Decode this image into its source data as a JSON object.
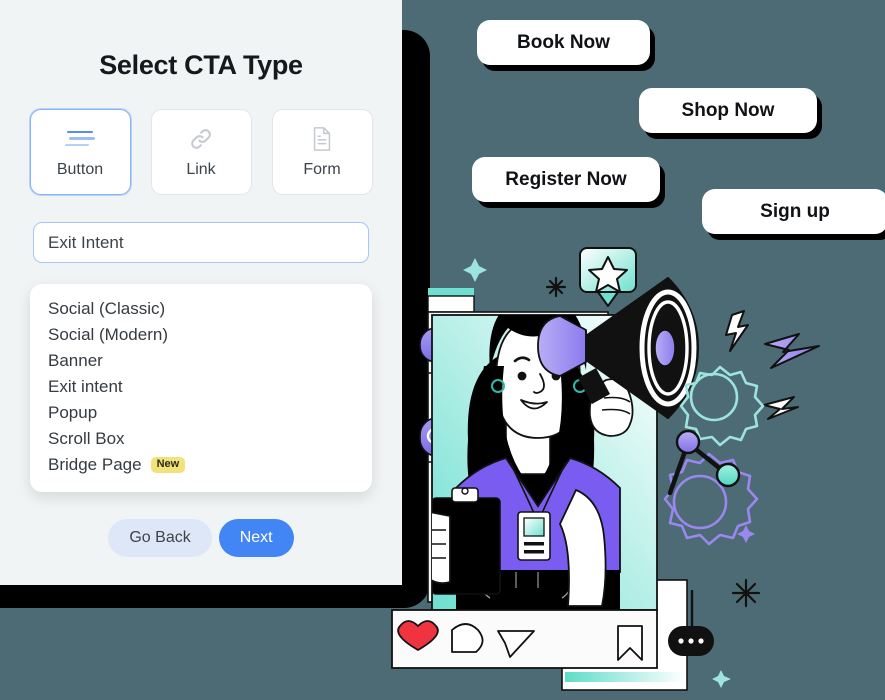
{
  "theme": {
    "background_teal": "#4c6b74",
    "panel_background": "#f1f4f5",
    "accent_blue": "#4285f4",
    "badge_yellow": "#f2e27a",
    "card_black": "#000000"
  },
  "panel": {
    "title": "Select CTA Type",
    "type_cards": [
      {
        "label": "Button",
        "icon": "lines-icon",
        "selected": true
      },
      {
        "label": "Link",
        "icon": "link-icon",
        "selected": false
      },
      {
        "label": "Form",
        "icon": "document-icon",
        "selected": false
      }
    ],
    "select_input": {
      "value": "Exit Intent",
      "placeholder": "Exit Intent"
    },
    "dropdown_options": [
      {
        "label": "Social (Classic)",
        "badge": ""
      },
      {
        "label": "Social (Modern)",
        "badge": ""
      },
      {
        "label": "Banner",
        "badge": ""
      },
      {
        "label": "Exit intent",
        "badge": ""
      },
      {
        "label": "Popup",
        "badge": ""
      },
      {
        "label": "Scroll Box",
        "badge": ""
      },
      {
        "label": "Bridge Page",
        "badge": "New"
      }
    ],
    "actions": {
      "back_label": "Go Back",
      "next_label": "Next"
    }
  },
  "preview": {
    "cta_buttons": [
      {
        "label": "Book Now"
      },
      {
        "label": "Shop Now"
      },
      {
        "label": "Register Now"
      },
      {
        "label": "Sign up"
      }
    ],
    "illustration": {
      "name": "marketing-megaphone-illustration",
      "social_actions": [
        "heart-icon",
        "comment-icon",
        "send-icon",
        "bookmark-icon"
      ]
    }
  }
}
